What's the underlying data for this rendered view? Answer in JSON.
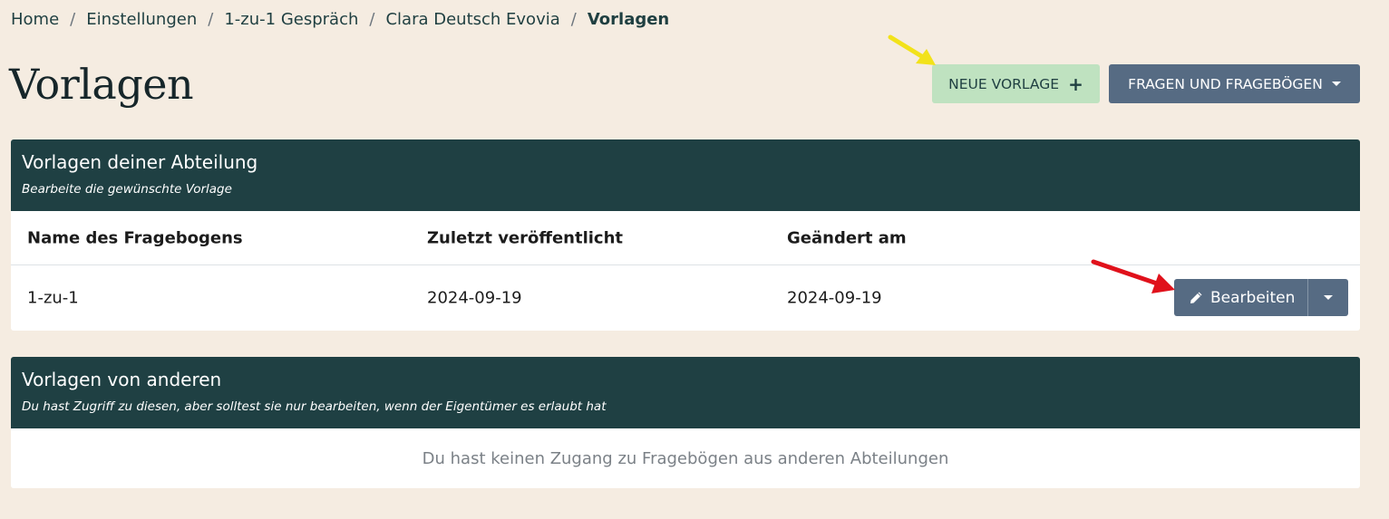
{
  "breadcrumb": {
    "items": [
      "Home",
      "Einstellungen",
      "1-zu-1 Gespräch",
      "Clara Deutsch Evovia"
    ],
    "separator": "/",
    "current": "Vorlagen"
  },
  "page": {
    "title": "Vorlagen"
  },
  "actions": {
    "new_template_label": "NEUE VORLAGE",
    "new_template_icon": "plus-icon",
    "questions_label": "FRAGEN UND FRAGEBÖGEN",
    "questions_icon": "caret-down-icon"
  },
  "own_templates": {
    "title": "Vorlagen deiner Abteilung",
    "subtitle": "Bearbeite die gewünschte Vorlage",
    "columns": [
      "Name des Fragebogens",
      "Zuletzt veröffentlicht",
      "Geändert am"
    ],
    "rows": [
      {
        "name": "1-zu-1",
        "published": "2024-09-19",
        "changed": "2024-09-19",
        "edit_label": "Bearbeiten"
      }
    ]
  },
  "other_templates": {
    "title": "Vorlagen von anderen",
    "subtitle": "Du hast Zugriff zu diesen, aber solltest sie nur bearbeiten, wenn der Eigentümer es erlaubt hat",
    "empty_message": "Du hast keinen Zugang zu Fragebögen aus anderen Abteilungen"
  },
  "colors": {
    "background": "#f5ece1",
    "card_header": "#1f4043",
    "primary_button": "#566b83",
    "success_button": "#bfe2c0",
    "annotation_yellow": "#f2e21a",
    "annotation_red": "#e0111b"
  }
}
